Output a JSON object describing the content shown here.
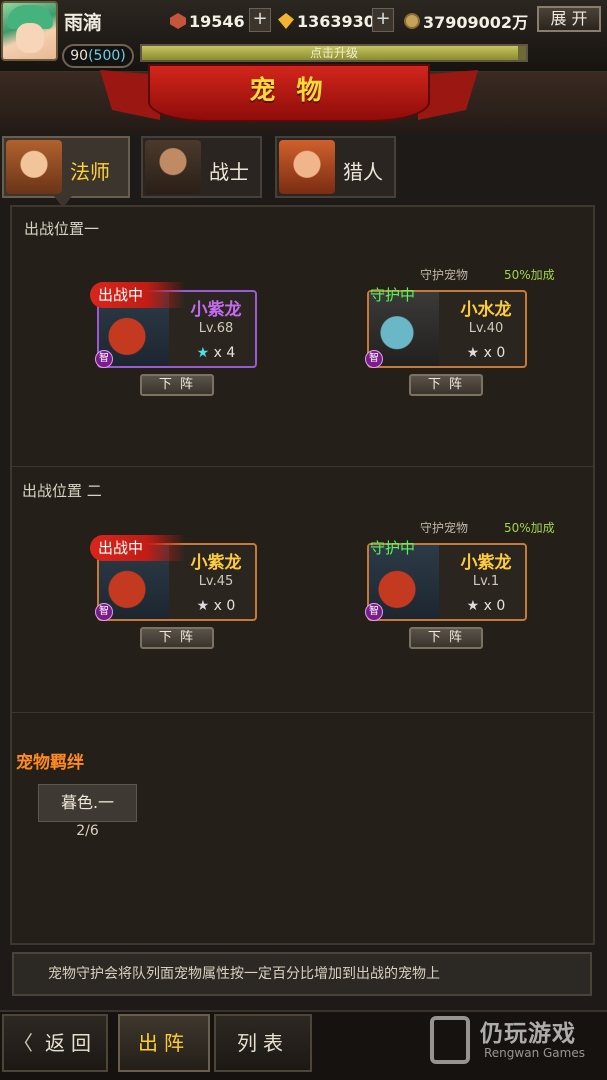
{
  "player": {
    "name": "雨滴",
    "level": "90",
    "level_max": "(500)",
    "exp_text": "点击升级",
    "exp_progress": 0.98
  },
  "resources": {
    "ruby": "19546",
    "gems": "1363930",
    "coins": "37909002万"
  },
  "header": {
    "expand_label": "展 开"
  },
  "title": "宠 物",
  "tabs": [
    {
      "label": "法师",
      "active": true
    },
    {
      "label": "战士",
      "active": false
    },
    {
      "label": "猎人",
      "active": false
    }
  ],
  "positions": [
    {
      "label": "出战位置一",
      "guard_label": "守护宠物",
      "bonus_label": "50%加成",
      "battle_pet": {
        "status": "出战中",
        "name": "小紫龙",
        "level": "Lv.68",
        "stars": "x 4",
        "attr": "智",
        "button": "下 阵"
      },
      "guard_pet": {
        "status": "守护中",
        "name": "小水龙",
        "level": "Lv.40",
        "stars": "x 0",
        "attr": "智",
        "button": "下 阵"
      }
    },
    {
      "label": "出战位置 二",
      "guard_label": "守护宠物",
      "bonus_label": "50%加成",
      "battle_pet": {
        "status": "出战中",
        "name": "小紫龙",
        "level": "Lv.45",
        "stars": "x 0",
        "attr": "智",
        "button": "下 阵"
      },
      "guard_pet": {
        "status": "守护中",
        "name": "小紫龙",
        "level": "Lv.1",
        "stars": "x 0",
        "attr": "智",
        "button": "下 阵"
      }
    }
  ],
  "bond": {
    "title": "宠物羁绊",
    "item_label": "暮色.一",
    "count": "2/6"
  },
  "tip": "宠物守护会将队列面宠物属性按一定百分比增加到出战的宠物上",
  "nav": {
    "back": "返回",
    "battle": "出阵",
    "list": "列表"
  },
  "watermark": {
    "cn": "仍玩游戏",
    "en": "Rengwan Games"
  },
  "colors": {
    "accent": "#ffd23a",
    "ribbon": "#c81d15",
    "guard_green": "#5ff25a",
    "bonus_green": "#9fd34a",
    "purple_name": "#c46bf0"
  }
}
